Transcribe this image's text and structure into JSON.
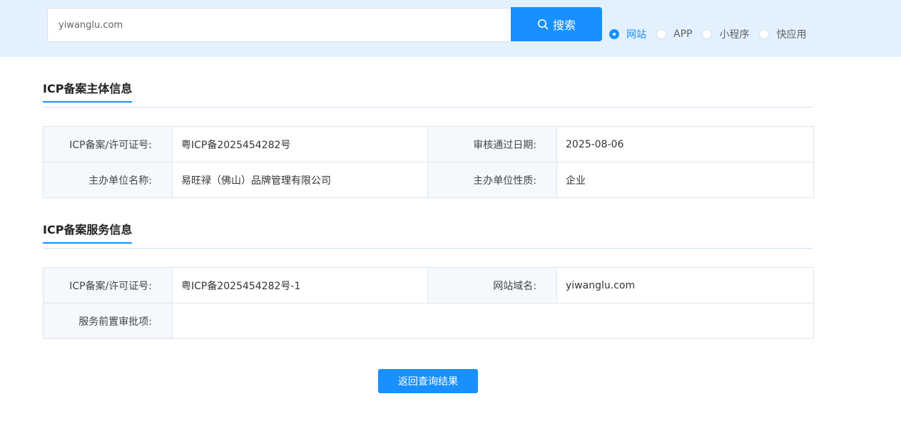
{
  "search": {
    "value": "yiwanglu.com",
    "button_label": "搜索"
  },
  "radio_options": [
    {
      "label": "网站",
      "checked": true
    },
    {
      "label": "APP",
      "checked": false
    },
    {
      "label": "小程序",
      "checked": false
    },
    {
      "label": "快应用",
      "checked": false
    }
  ],
  "subject_section": {
    "title": "ICP备案主体信息",
    "rows": [
      {
        "label1": "ICP备案/许可证号:",
        "value1": "粤ICP备2025454282号",
        "label2": "审核通过日期:",
        "value2": "2025-08-06"
      },
      {
        "label1": "主办单位名称:",
        "value1": "易旺禄（佛山）品牌管理有限公司",
        "label2": "主办单位性质:",
        "value2": "企业"
      }
    ]
  },
  "service_section": {
    "title": "ICP备案服务信息",
    "license_label": "ICP备案/许可证号:",
    "license_value": "粤ICP备2025454282号-1",
    "domain_label": "网站域名:",
    "domain_value": "yiwanglu.com",
    "approval_label": "服务前置审批项:",
    "approval_value": ""
  },
  "back_button_label": "返回查询结果",
  "colors": {
    "accent": "#1890ff",
    "topbar": "#e3f1fe",
    "label_bg": "#f5f9fd"
  }
}
